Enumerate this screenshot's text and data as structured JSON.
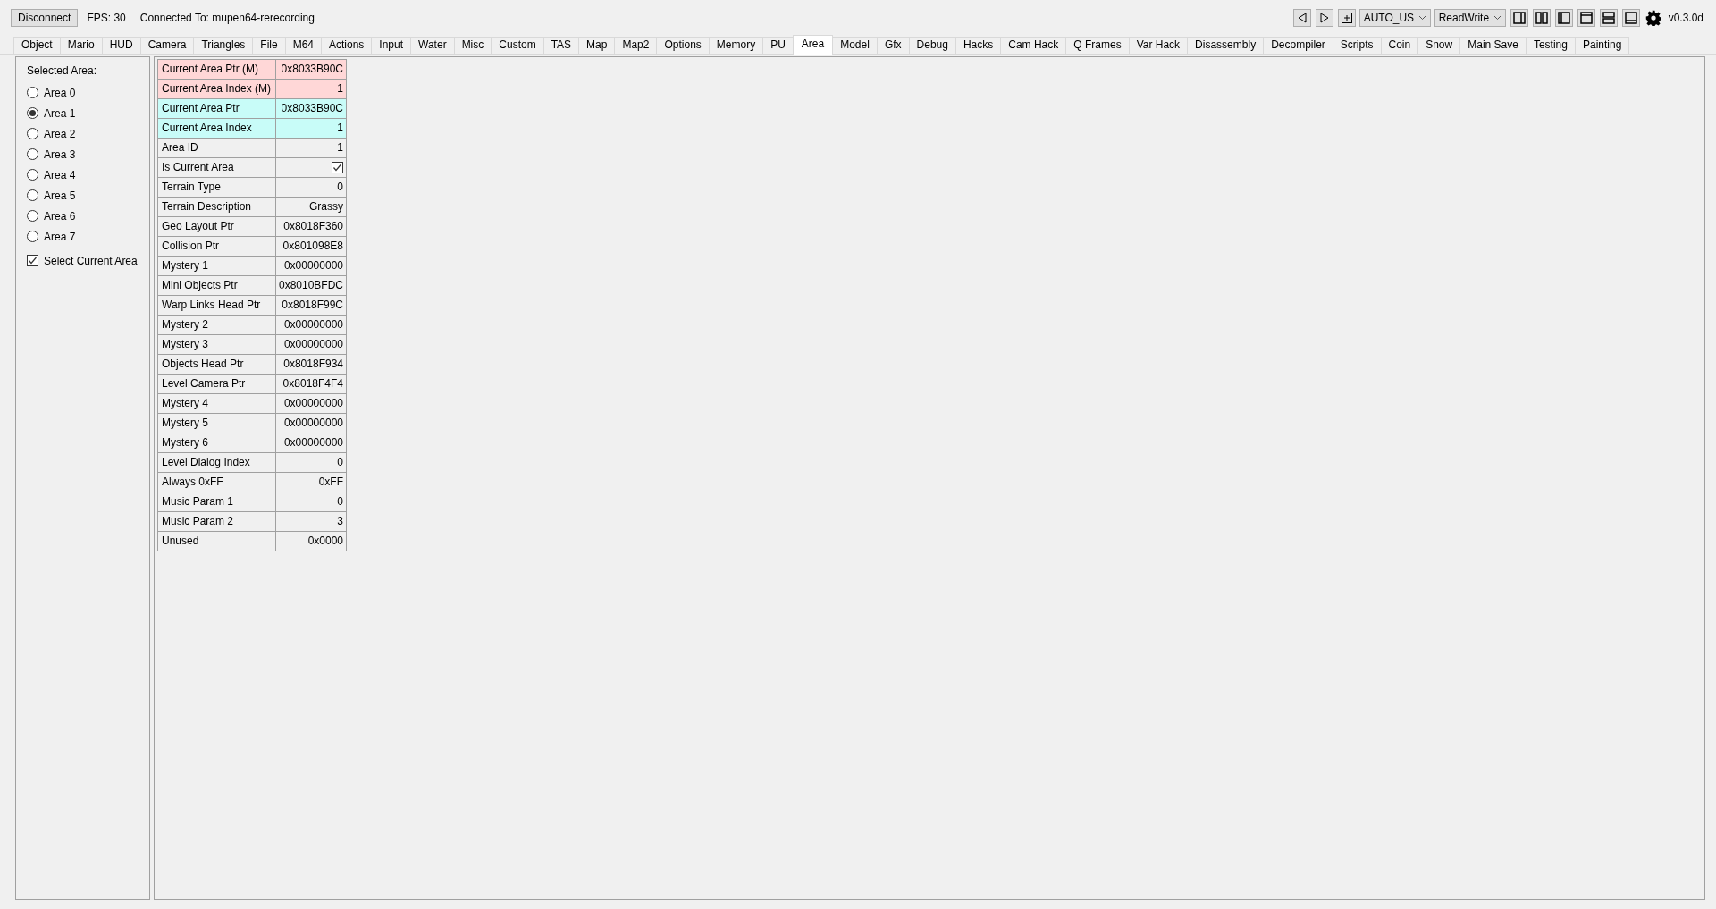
{
  "toolbar": {
    "disconnect_button": "Disconnect",
    "fps": "FPS: 30",
    "connection": "Connected To: mupen64-rerecording",
    "region_dropdown": "AUTO_US",
    "mode_dropdown": "ReadWrite",
    "version": "v0.3.0d"
  },
  "tabs": [
    {
      "label": "Object",
      "selected": false
    },
    {
      "label": "Mario",
      "selected": false
    },
    {
      "label": "HUD",
      "selected": false
    },
    {
      "label": "Camera",
      "selected": false
    },
    {
      "label": "Triangles",
      "selected": false
    },
    {
      "label": "File",
      "selected": false
    },
    {
      "label": "M64",
      "selected": false
    },
    {
      "label": "Actions",
      "selected": false
    },
    {
      "label": "Input",
      "selected": false
    },
    {
      "label": "Water",
      "selected": false
    },
    {
      "label": "Misc",
      "selected": false
    },
    {
      "label": "Custom",
      "selected": false
    },
    {
      "label": "TAS",
      "selected": false
    },
    {
      "label": "Map",
      "selected": false
    },
    {
      "label": "Map2",
      "selected": false
    },
    {
      "label": "Options",
      "selected": false
    },
    {
      "label": "Memory",
      "selected": false
    },
    {
      "label": "PU",
      "selected": false
    },
    {
      "label": "Area",
      "selected": true
    },
    {
      "label": "Model",
      "selected": false
    },
    {
      "label": "Gfx",
      "selected": false
    },
    {
      "label": "Debug",
      "selected": false
    },
    {
      "label": "Hacks",
      "selected": false
    },
    {
      "label": "Cam Hack",
      "selected": false
    },
    {
      "label": "Q Frames",
      "selected": false
    },
    {
      "label": "Var Hack",
      "selected": false
    },
    {
      "label": "Disassembly",
      "selected": false
    },
    {
      "label": "Decompiler",
      "selected": false
    },
    {
      "label": "Scripts",
      "selected": false
    },
    {
      "label": "Coin",
      "selected": false
    },
    {
      "label": "Snow",
      "selected": false
    },
    {
      "label": "Main Save",
      "selected": false
    },
    {
      "label": "Testing",
      "selected": false
    },
    {
      "label": "Painting",
      "selected": false
    }
  ],
  "area_panel": {
    "label": "Selected Area:",
    "areas": [
      {
        "label": "Area 0",
        "selected": false
      },
      {
        "label": "Area 1",
        "selected": true
      },
      {
        "label": "Area 2",
        "selected": false
      },
      {
        "label": "Area 3",
        "selected": false
      },
      {
        "label": "Area 4",
        "selected": false
      },
      {
        "label": "Area 5",
        "selected": false
      },
      {
        "label": "Area 6",
        "selected": false
      },
      {
        "label": "Area 7",
        "selected": false
      }
    ],
    "select_current": {
      "label": "Select Current Area",
      "checked": true
    }
  },
  "variables": [
    {
      "name": "Current Area Ptr (M)",
      "kind": "text",
      "value": "0x8033B90C",
      "color": "#ffd7d7"
    },
    {
      "name": "Current Area Index (M)",
      "kind": "text",
      "value": "1",
      "color": "#ffd7d7"
    },
    {
      "name": "Current Area Ptr",
      "kind": "text",
      "value": "0x8033B90C",
      "color": "#c8fcf8"
    },
    {
      "name": "Current Area Index",
      "kind": "text",
      "value": "1",
      "color": "#c8fcf8"
    },
    {
      "name": "Area ID",
      "kind": "text",
      "value": "1",
      "color": "#f0f0f0"
    },
    {
      "name": "Is Current Area",
      "kind": "checkbox",
      "checked": true,
      "color": "#f0f0f0"
    },
    {
      "name": "Terrain Type",
      "kind": "text",
      "value": "0",
      "color": "#f0f0f0"
    },
    {
      "name": "Terrain Description",
      "kind": "text",
      "value": "Grassy",
      "color": "#f0f0f0"
    },
    {
      "name": "Geo Layout Ptr",
      "kind": "text",
      "value": "0x8018F360",
      "color": "#f0f0f0"
    },
    {
      "name": "Collision Ptr",
      "kind": "text",
      "value": "0x801098E8",
      "color": "#f0f0f0"
    },
    {
      "name": "Mystery 1",
      "kind": "text",
      "value": "0x00000000",
      "color": "#f0f0f0"
    },
    {
      "name": "Mini Objects Ptr",
      "kind": "text",
      "value": "0x8010BFDC",
      "color": "#f0f0f0"
    },
    {
      "name": "Warp Links Head Ptr",
      "kind": "text",
      "value": "0x8018F99C",
      "color": "#f0f0f0"
    },
    {
      "name": "Mystery 2",
      "kind": "text",
      "value": "0x00000000",
      "color": "#f0f0f0"
    },
    {
      "name": "Mystery 3",
      "kind": "text",
      "value": "0x00000000",
      "color": "#f0f0f0"
    },
    {
      "name": "Objects Head Ptr",
      "kind": "text",
      "value": "0x8018F934",
      "color": "#f0f0f0"
    },
    {
      "name": "Level Camera Ptr",
      "kind": "text",
      "value": "0x8018F4F4",
      "color": "#f0f0f0"
    },
    {
      "name": "Mystery 4",
      "kind": "text",
      "value": "0x00000000",
      "color": "#f0f0f0"
    },
    {
      "name": "Mystery 5",
      "kind": "text",
      "value": "0x00000000",
      "color": "#f0f0f0"
    },
    {
      "name": "Mystery 6",
      "kind": "text",
      "value": "0x00000000",
      "color": "#f0f0f0"
    },
    {
      "name": "Level Dialog Index",
      "kind": "text",
      "value": "0",
      "color": "#f0f0f0"
    },
    {
      "name": "Always 0xFF",
      "kind": "text",
      "value": "0xFF",
      "color": "#f0f0f0"
    },
    {
      "name": "Music Param 1",
      "kind": "text",
      "value": "0",
      "color": "#f0f0f0"
    },
    {
      "name": "Music Param 2",
      "kind": "text",
      "value": "3",
      "color": "#f0f0f0"
    },
    {
      "name": "Unused",
      "kind": "text",
      "value": "0x0000",
      "color": "#f0f0f0"
    }
  ]
}
